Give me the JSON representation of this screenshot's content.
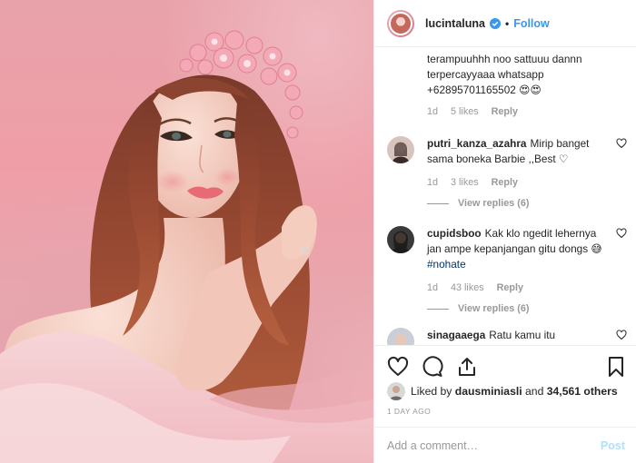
{
  "post": {
    "username": "lucintaluna",
    "follow_label": "Follow",
    "dot": "•"
  },
  "comments": [
    {
      "username": "",
      "text": "terampuuhhh noo sattuuu dannn terpercayyaaa whatsapp +62895701165502 😍😍",
      "age": "1d",
      "likes": "5 likes",
      "reply": "Reply"
    },
    {
      "username": "putri_kanza_azahra",
      "text": "Mirip banget sama boneka Barbie ,,Best ♡",
      "age": "1d",
      "likes": "3 likes",
      "reply": "Reply",
      "view_replies": "View replies (6)"
    },
    {
      "username": "cupidsboo",
      "text": "Kak klo ngedit lehernya jan ampe kepanjangan gitu dongs 😅",
      "hashtag": "#nohate",
      "age": "1d",
      "likes": "43 likes",
      "reply": "Reply",
      "view_replies": "View replies (6)"
    },
    {
      "username": "sinagaaega",
      "text": "Ratu kamu itu"
    }
  ],
  "likes": {
    "prefix": "Liked by",
    "user": "dausminiasli",
    "middle": "and",
    "count": "34,561 others"
  },
  "timestamp": "1 DAY AGO",
  "add_comment": {
    "placeholder": "Add a comment…",
    "post_label": "Post"
  },
  "icons": {
    "like": "heart-icon",
    "comment": "comment-icon",
    "share": "share-icon",
    "save": "bookmark-icon",
    "verified": "verified-badge-icon"
  },
  "colors": {
    "link_blue": "#3897f0",
    "post_disabled": "#b2dffc",
    "secondary_text": "#999999",
    "hashtag": "#003569"
  }
}
